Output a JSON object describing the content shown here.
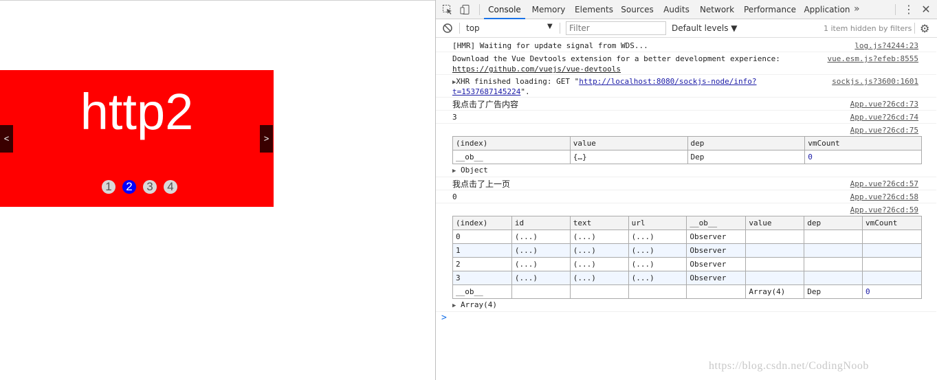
{
  "page": {
    "slide_text": "http2",
    "prev_label": "<",
    "next_label": ">",
    "dots": [
      "1",
      "2",
      "3",
      "4"
    ],
    "active_dot": "2",
    "colors": {
      "slide_bg": "#ff0000",
      "dot_active": "#0000ff",
      "dot": "#d9d9d9"
    }
  },
  "devtools": {
    "tabs": [
      "Console",
      "Memory",
      "Elements",
      "Sources",
      "Audits",
      "Network",
      "Performance",
      "Application"
    ],
    "active_tab": "Console",
    "more_tabs": "»",
    "context": "top",
    "filter_placeholder": "Filter",
    "levels": "Default levels ▼",
    "hidden_note": "1 item hidden by filters",
    "icons": [
      "inspect-element-icon",
      "device-toolbar-icon",
      "more-tabs-icon",
      "kebab-menu-icon",
      "close-icon",
      "clear-console-icon",
      "dropdown-arrow-icon",
      "settings-gear-icon",
      "disclosure-triangle-icon",
      "console-prompt-icon"
    ]
  },
  "console": {
    "m1": {
      "text": "[HMR] Waiting for update signal from WDS...",
      "src": "log.js?4244:23"
    },
    "m2": {
      "text": "Download the Vue Devtools extension for a better development experience:",
      "link": "https://github.com/vuejs/vue-devtools",
      "src": "vue.esm.js?efeb:8555"
    },
    "m3": {
      "prefix": "XHR finished loading: GET \"",
      "link1": "http://localhost:8080/sockjs-node/info?",
      "link2": "t=1537687145224",
      "suffix": "\".",
      "src": "sockjs.js?3600:1601"
    },
    "m4": {
      "text": "我点击了广告内容",
      "src": "App.vue?26cd:73"
    },
    "m5": {
      "text": "3",
      "src": "App.vue?26cd:74"
    },
    "m6": {
      "src": "App.vue?26cd:75"
    },
    "table1": {
      "headers": [
        "(index)",
        "value",
        "dep",
        "vmCount"
      ],
      "row": [
        "__ob__",
        "{…}",
        "Dep",
        "0"
      ],
      "footer": "Object"
    },
    "m7": {
      "text": "我点击了上一页",
      "src": "App.vue?26cd:57"
    },
    "m8": {
      "text": "0",
      "src": "App.vue?26cd:58"
    },
    "m9": {
      "src": "App.vue?26cd:59"
    },
    "table2": {
      "headers": [
        "(index)",
        "id",
        "text",
        "url",
        "__ob__",
        "value",
        "dep",
        "vmCount"
      ],
      "rows": [
        [
          "0",
          "(...)",
          "(...)",
          "(...)",
          "Observer",
          "",
          "",
          ""
        ],
        [
          "1",
          "(...)",
          "(...)",
          "(...)",
          "Observer",
          "",
          "",
          ""
        ],
        [
          "2",
          "(...)",
          "(...)",
          "(...)",
          "Observer",
          "",
          "",
          ""
        ],
        [
          "3",
          "(...)",
          "(...)",
          "(...)",
          "Observer",
          "",
          "",
          ""
        ],
        [
          "__ob__",
          "",
          "",
          "",
          "",
          "Array(4)",
          "Dep",
          "0"
        ]
      ],
      "footer": "Array(4)"
    },
    "prompt": ">"
  },
  "watermark": "https://blog.csdn.net/CodingNoob"
}
